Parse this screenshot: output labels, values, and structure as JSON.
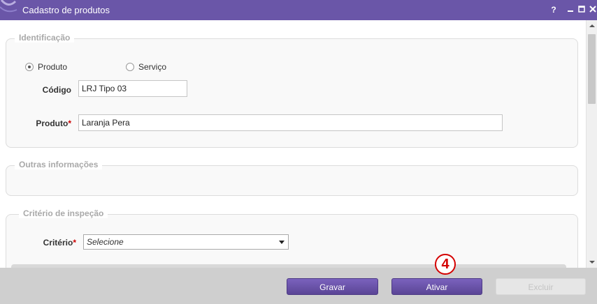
{
  "window": {
    "title": "Cadastro de produtos",
    "help_label": "?",
    "colors": {
      "titlebar": "#6a56a8",
      "button": "#6a52ad",
      "required": "#cc0000",
      "callout": "#d40000"
    }
  },
  "identificacao": {
    "legend": "Identificação",
    "type_options": [
      {
        "label": "Produto",
        "selected": true
      },
      {
        "label": "Serviço",
        "selected": false
      }
    ],
    "codigo": {
      "label": "Código",
      "value": "LRJ Tipo 03"
    },
    "produto": {
      "label": "Produto",
      "required_mark": "*",
      "value": "Laranja Pera"
    }
  },
  "outras": {
    "legend": "Outras informações"
  },
  "criterio": {
    "legend": "Critério de inspeção",
    "label": "Critério",
    "required_mark": "*",
    "selected": "Selecione"
  },
  "footer": {
    "gravar": "Gravar",
    "ativar": "Ativar",
    "excluir": "Excluir"
  },
  "annotation": {
    "step": "4"
  },
  "icons": [
    "app-logo-icon",
    "minimize-icon",
    "maximize-icon",
    "close-icon",
    "radio-icon",
    "chevron-down-icon",
    "scroll-up-icon",
    "scroll-down-icon"
  ]
}
